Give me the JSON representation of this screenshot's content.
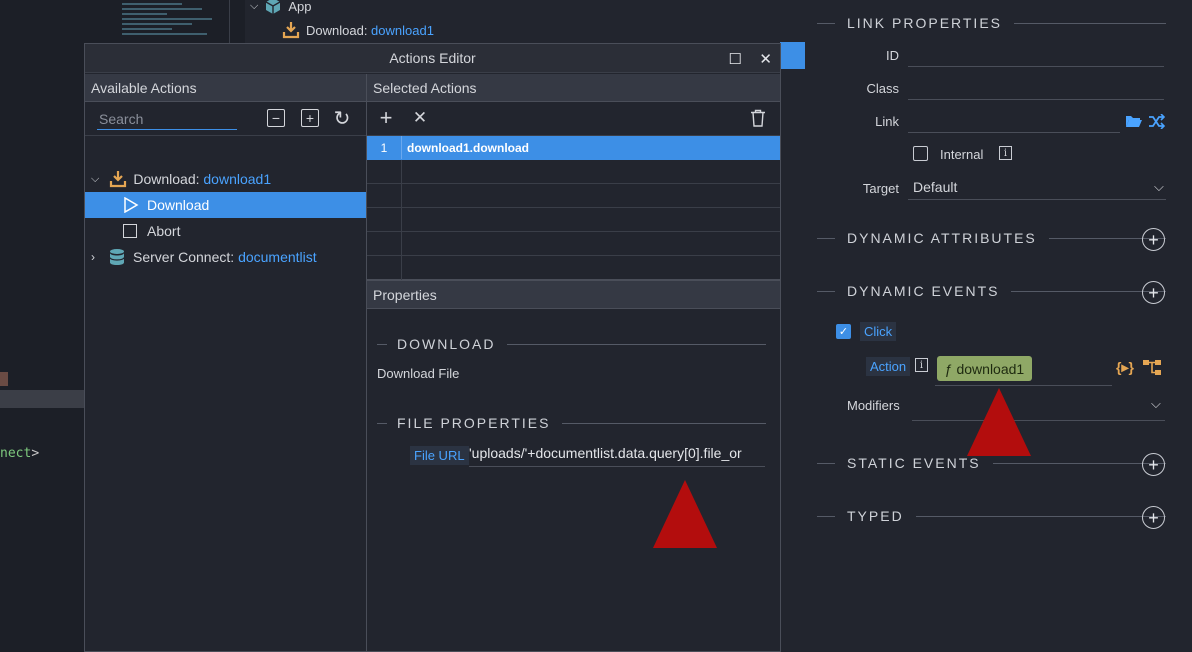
{
  "background": {
    "code_text": "nect",
    "code_gt": ">",
    "tree": {
      "app_label": "App",
      "download_prefix": "Download: ",
      "download_name": "download1"
    }
  },
  "dialog": {
    "title": "Actions Editor",
    "maximize_glyph": "☐",
    "close_glyph": "✕",
    "available": {
      "header": "Available Actions",
      "search_placeholder": "Search",
      "items": [
        {
          "prefix": "Download: ",
          "name": "download1"
        },
        {
          "label": "Download"
        },
        {
          "label": "Abort"
        },
        {
          "prefix": "Server Connect: ",
          "name": "documentlist"
        }
      ]
    },
    "selected": {
      "header": "Selected Actions",
      "rows": [
        {
          "num": "1",
          "value": "download1.download"
        }
      ]
    },
    "properties": {
      "header": "Properties",
      "section1": "DOWNLOAD",
      "section1_desc": "Download File",
      "section2": "FILE PROPERTIES",
      "file_url_label": "File URL",
      "file_url_value": "'uploads/'+documentlist.data.query[0].file_or"
    }
  },
  "right_panel": {
    "link_properties": "LINK PROPERTIES",
    "id_label": "ID",
    "class_label": "Class",
    "link_label": "Link",
    "internal_label": "Internal",
    "target_label": "Target",
    "target_value": "Default",
    "dynamic_attributes": "DYNAMIC ATTRIBUTES",
    "dynamic_events": "DYNAMIC EVENTS",
    "click_label": "Click",
    "action_label": "Action",
    "action_value": "ƒ download1",
    "modifiers_label": "Modifiers",
    "static_events": "STATIC EVENTS",
    "typed": "TYPED"
  },
  "colors": {
    "accent": "#3d8fe6",
    "annotation_red": "#b30d0d",
    "action_chip": "#8fa866"
  }
}
